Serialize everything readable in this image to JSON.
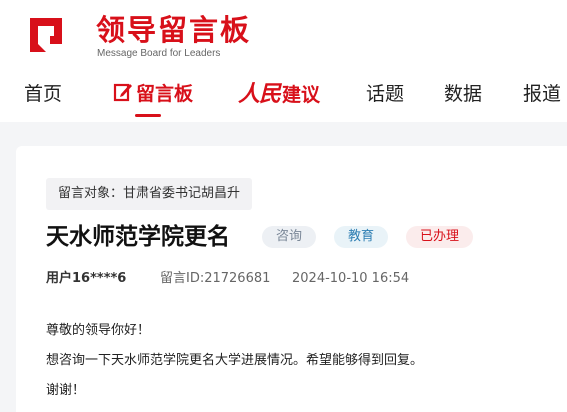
{
  "brand": {
    "title": "领导留言板",
    "subtitle": "Message Board for Leaders",
    "color": "#d8101a"
  },
  "nav": {
    "items": [
      {
        "label": "首页"
      },
      {
        "label": "留言板",
        "icon": "edit-icon",
        "active": true
      },
      {
        "label_script": "人民",
        "label": "建议"
      },
      {
        "label": "话题"
      },
      {
        "label": "数据"
      },
      {
        "label": "报道"
      }
    ]
  },
  "message": {
    "target_prefix": "留言对象：",
    "target": "甘肃省委书记胡昌升",
    "title": "天水师范学院更名",
    "badges": {
      "type": "咨询",
      "field": "教育",
      "status": "已办理"
    },
    "user": "用户16****6",
    "id_text": "留言ID:21726681",
    "time": "2024-10-10 16:54",
    "body": [
      "尊敬的领导你好！",
      "想咨询一下天水师范学院更名大学进展情况。希望能够得到回复。",
      "谢谢！"
    ]
  }
}
